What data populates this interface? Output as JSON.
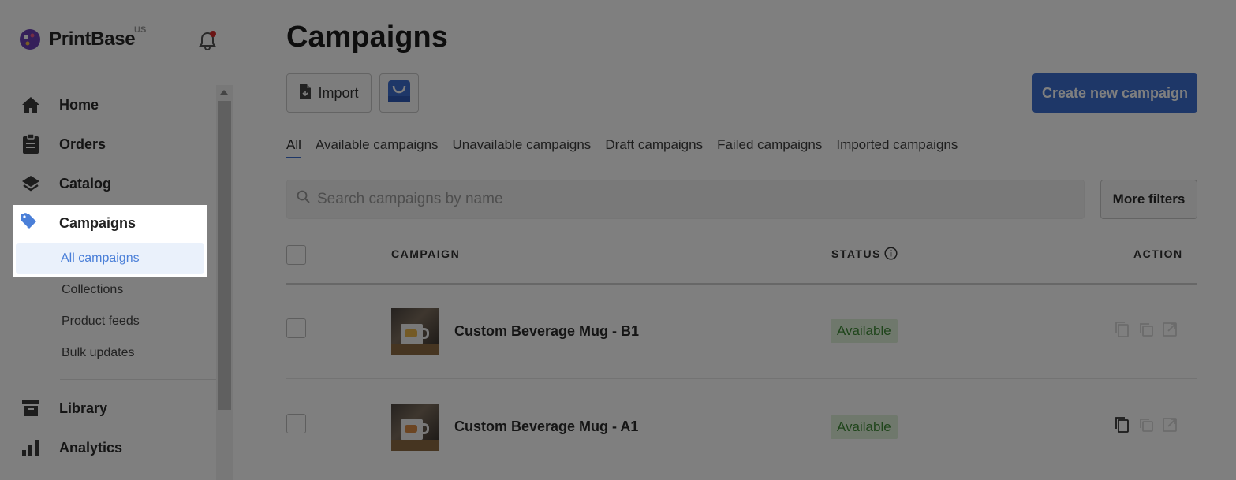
{
  "brand": {
    "name": "PrintBase",
    "region": "US"
  },
  "sidebar": {
    "items": [
      {
        "label": "Home",
        "icon": "home-icon"
      },
      {
        "label": "Orders",
        "icon": "clipboard-icon"
      },
      {
        "label": "Catalog",
        "icon": "layers-icon"
      },
      {
        "label": "Campaigns",
        "icon": "tags-icon"
      },
      {
        "label": "Library",
        "icon": "archive-icon"
      },
      {
        "label": "Analytics",
        "icon": "bar-chart-icon"
      }
    ],
    "campaign_subitems": [
      {
        "label": "All campaigns",
        "active": true
      },
      {
        "label": "Collections"
      },
      {
        "label": "Product feeds"
      },
      {
        "label": "Bulk updates"
      }
    ]
  },
  "header": {
    "title": "Campaigns",
    "import_label": "Import",
    "create_label": "Create new campaign"
  },
  "tabs": [
    {
      "label": "All",
      "active": true
    },
    {
      "label": "Available campaigns"
    },
    {
      "label": "Unavailable campaigns"
    },
    {
      "label": "Draft campaigns"
    },
    {
      "label": "Failed campaigns"
    },
    {
      "label": "Imported campaigns"
    }
  ],
  "search": {
    "placeholder": "Search campaigns by name",
    "filters_label": "More filters"
  },
  "table": {
    "columns": {
      "campaign": "CAMPAIGN",
      "status": "STATUS",
      "action": "ACTION"
    },
    "rows": [
      {
        "name": "Custom Beverage Mug - B1",
        "status": "Available"
      },
      {
        "name": "Custom Beverage Mug - A1",
        "status": "Available"
      }
    ]
  },
  "colors": {
    "accent": "#3d6fd1",
    "available_bg": "#dff0d8",
    "available_text": "#3e8a36"
  }
}
